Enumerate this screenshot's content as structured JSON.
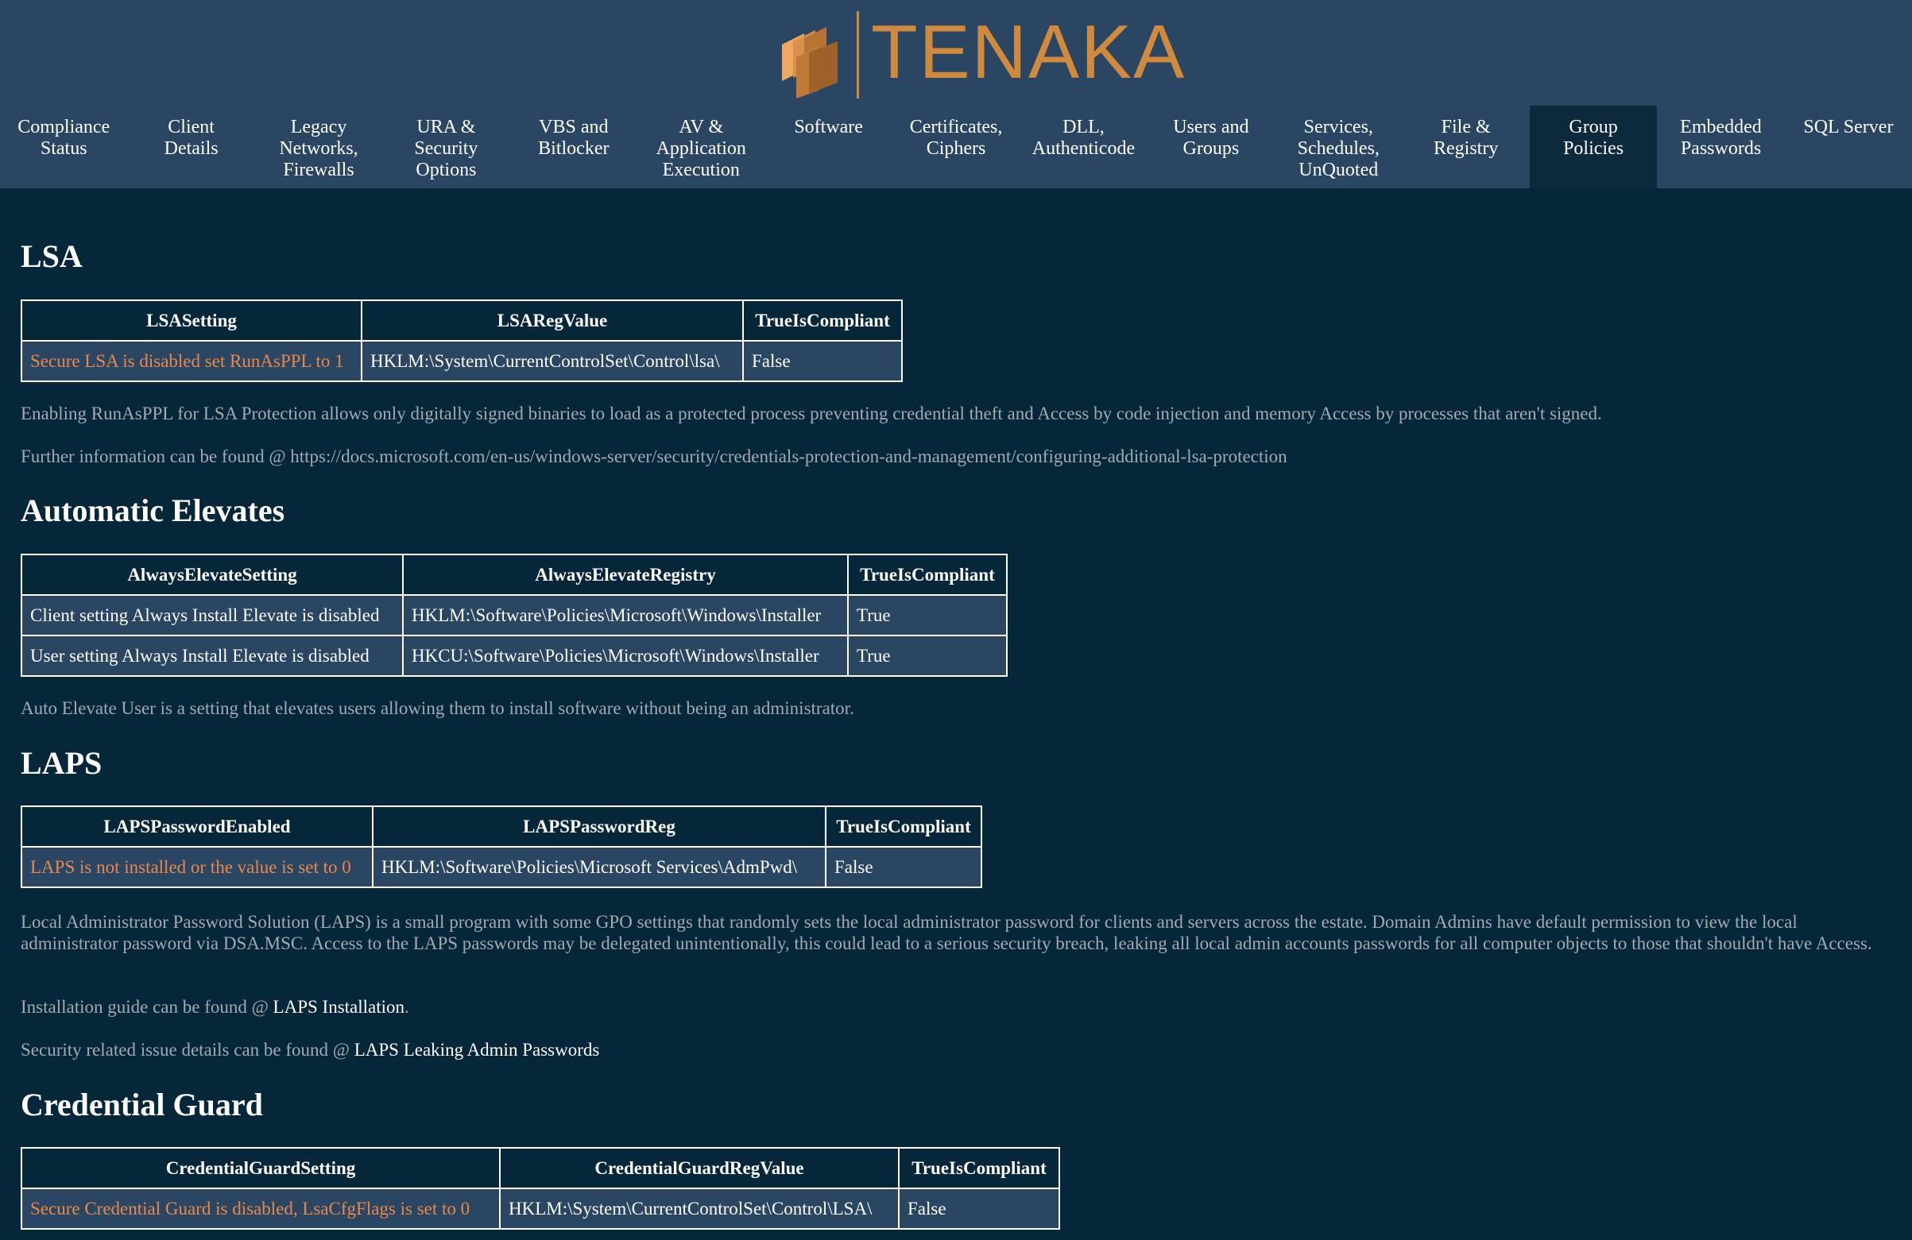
{
  "brand": {
    "name": "TENAKA",
    "accent_color": "#d08a3e",
    "logo_icon": "stacked-cubes-icon"
  },
  "colors": {
    "header_bg": "#2a4663",
    "page_bg": "#06263a",
    "active_tab_bg": "#0d2a3d",
    "fail_text": "#e8894a",
    "note_text": "#a3aab3"
  },
  "tabs": [
    {
      "label": "Compliance\nStatus"
    },
    {
      "label": "Client\nDetails"
    },
    {
      "label": "Legacy\nNetworks,\nFirewalls"
    },
    {
      "label": "URA &\nSecurity\nOptions"
    },
    {
      "label": "VBS and\nBitlocker"
    },
    {
      "label": "AV &\nApplication\nExecution"
    },
    {
      "label": "Software"
    },
    {
      "label": "Certificates,\nCiphers"
    },
    {
      "label": "DLL,\nAuthenticode"
    },
    {
      "label": "Users and\nGroups"
    },
    {
      "label": "Services,\nSchedules,\nUnQuoted"
    },
    {
      "label": "File &\nRegistry"
    },
    {
      "label": "Group\nPolicies",
      "active": true
    },
    {
      "label": "Embedded\nPasswords"
    },
    {
      "label": "SQL Server"
    }
  ],
  "lsa": {
    "heading": "LSA",
    "headers": [
      "LSASetting",
      "LSARegValue",
      "TrueIsCompliant"
    ],
    "rows": [
      [
        "Secure LSA is disabled set RunAsPPL to 1",
        "HKLM:\\System\\CurrentControlSet\\Control\\lsa\\",
        "False"
      ]
    ],
    "note1": "Enabling RunAsPPL for LSA Protection allows only digitally signed binaries to load as a protected process preventing credential theft and Access by code injection and memory Access by processes that aren't signed.",
    "note2": "Further information can be found @ https://docs.microsoft.com/en-us/windows-server/security/credentials-protection-and-management/configuring-additional-lsa-protection"
  },
  "elevate": {
    "heading": "Automatic Elevates",
    "headers": [
      "AlwaysElevateSetting",
      "AlwaysElevateRegistry",
      "TrueIsCompliant"
    ],
    "rows": [
      [
        "Client setting Always Install Elevate is disabled",
        "HKLM:\\Software\\Policies\\Microsoft\\Windows\\Installer",
        "True"
      ],
      [
        "User setting Always Install Elevate is disabled",
        "HKCU:\\Software\\Policies\\Microsoft\\Windows\\Installer",
        "True"
      ]
    ],
    "note1": "Auto Elevate User is a setting that elevates users allowing them to install software without being an administrator."
  },
  "laps": {
    "heading": "LAPS",
    "headers": [
      "LAPSPasswordEnabled",
      "LAPSPasswordReg",
      "TrueIsCompliant"
    ],
    "rows": [
      [
        "LAPS is not installed or the value is set to 0",
        "HKLM:\\Software\\Policies\\Microsoft Services\\AdmPwd\\",
        "False"
      ]
    ],
    "note1": "Local Administrator Password Solution (LAPS) is a small program with some GPO settings that randomly sets the local administrator password for clients and servers across the estate. Domain Admins have default permission to view the local administrator password via DSA.MSC. Access to the LAPS passwords may be delegated unintentionally, this could lead to a serious security breach, leaking all local admin accounts passwords for all computer objects to those that shouldn't have Access.",
    "install_prefix": "Installation guide can be found @ ",
    "install_link": "LAPS Installation",
    "install_suffix": ".",
    "security_prefix": "Security related issue details can be found @ ",
    "security_link": "LAPS Leaking Admin Passwords"
  },
  "credguard": {
    "heading": "Credential Guard",
    "headers": [
      "CredentialGuardSetting",
      "CredentialGuardRegValue",
      "TrueIsCompliant"
    ],
    "rows": [
      [
        "Secure Credential Guard is disabled, LsaCfgFlags is set to 0",
        "HKLM:\\System\\CurrentControlSet\\Control\\LSA\\",
        "False"
      ]
    ]
  }
}
